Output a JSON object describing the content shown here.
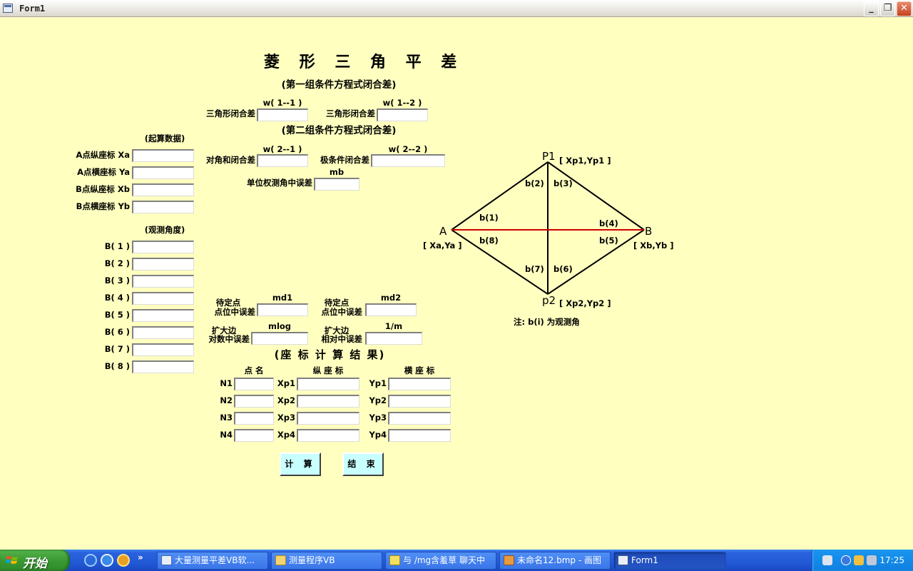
{
  "window": {
    "title": "Form1",
    "min_glyph": "_",
    "max_glyph": "❐",
    "close_glyph": "✕"
  },
  "form": {
    "title": "菱 形 三 角 平 差",
    "group1_header": "(第一组条件方程式闭合差)",
    "group2_header": "(第二组条件方程式闭合差)",
    "start_data_header": "(起算数据)",
    "obs_header": "(观测角度)",
    "result_header": "(座 标 计 算 结 果)",
    "w11": {
      "label": "三角形闭合差",
      "top": "w( 1--1 )",
      "value": ""
    },
    "w12": {
      "label": "三角形闭合差",
      "top": "w( 1--2 )",
      "value": ""
    },
    "w21": {
      "label": "对角和闭合差",
      "top": "w( 2--1 )",
      "value": ""
    },
    "w22": {
      "label": "极条件闭合差",
      "top": "w( 2--2 )",
      "value": ""
    },
    "mb": {
      "label": "单位权测角中误差",
      "top": "mb",
      "value": ""
    },
    "start_fields": [
      {
        "label": "A点纵座标 Xa",
        "value": ""
      },
      {
        "label": "A点横座标 Ya",
        "value": ""
      },
      {
        "label": "B点纵座标 Xb",
        "value": ""
      },
      {
        "label": "B点横座标 Yb",
        "value": ""
      }
    ],
    "obs_fields": [
      {
        "label": "B( 1 )",
        "value": ""
      },
      {
        "label": "B( 2 )",
        "value": ""
      },
      {
        "label": "B( 3 )",
        "value": ""
      },
      {
        "label": "B( 4 )",
        "value": ""
      },
      {
        "label": "B( 5 )",
        "value": ""
      },
      {
        "label": "B( 6 )",
        "value": ""
      },
      {
        "label": "B( 7 )",
        "value": ""
      },
      {
        "label": "B( 8 )",
        "value": ""
      }
    ],
    "md1": {
      "label1": "待定点",
      "label2": "点位中误差",
      "top": "md1",
      "value": ""
    },
    "md2": {
      "label1": "待定点",
      "label2": "点位中误差",
      "top": "md2",
      "value": ""
    },
    "mlog": {
      "label1": "扩大边",
      "label2": "对数中误差",
      "top": "mlog",
      "value": ""
    },
    "rel": {
      "label1": "扩大边",
      "label2": "相对中误差",
      "top": "1/m",
      "value": ""
    },
    "result_cols": {
      "name": "点  名",
      "x": "纵 座 标",
      "y": "横  座  标"
    },
    "result_rows": [
      {
        "n": "N1",
        "xl": "Xp1",
        "yl": "Yp1",
        "name": "",
        "x": "",
        "y": ""
      },
      {
        "n": "N2",
        "xl": "Xp2",
        "yl": "Yp2",
        "name": "",
        "x": "",
        "y": ""
      },
      {
        "n": "N3",
        "xl": "Xp3",
        "yl": "Yp3",
        "name": "",
        "x": "",
        "y": ""
      },
      {
        "n": "N4",
        "xl": "Xp4",
        "yl": "Yp4",
        "name": "",
        "x": "",
        "y": ""
      }
    ],
    "calc_button": "计 算",
    "end_button": "结 束"
  },
  "diagram": {
    "A": "A",
    "B": "B",
    "P1": "P1",
    "P2": "p2",
    "A_coord": "[ Xa,Ya ]",
    "B_coord": "[ Xb,Yb ]",
    "P1_coord": "[ Xp1,Yp1 ]",
    "P2_coord": "[ Xp2,Yp2 ]",
    "b1": "b(1)",
    "b2": "b(2)",
    "b3": "b(3)",
    "b4": "b(4)",
    "b5": "b(5)",
    "b6": "b(6)",
    "b7": "b(7)",
    "b8": "b(8)",
    "note": "注: b(i) 为观测角",
    "line_color": "#000000",
    "baseline_color": "#d00000"
  },
  "taskbar": {
    "start_label": "开始",
    "chevron": "»",
    "items": [
      {
        "label": "大量测量平差VB软...",
        "active": false
      },
      {
        "label": "测量程序VB",
        "active": false
      },
      {
        "label": "与 /mg含羞草 聊天中",
        "active": false
      },
      {
        "label": "未命名12.bmp - 画图",
        "active": false
      },
      {
        "label": "Form1",
        "active": true
      }
    ],
    "clock": "17:25"
  }
}
